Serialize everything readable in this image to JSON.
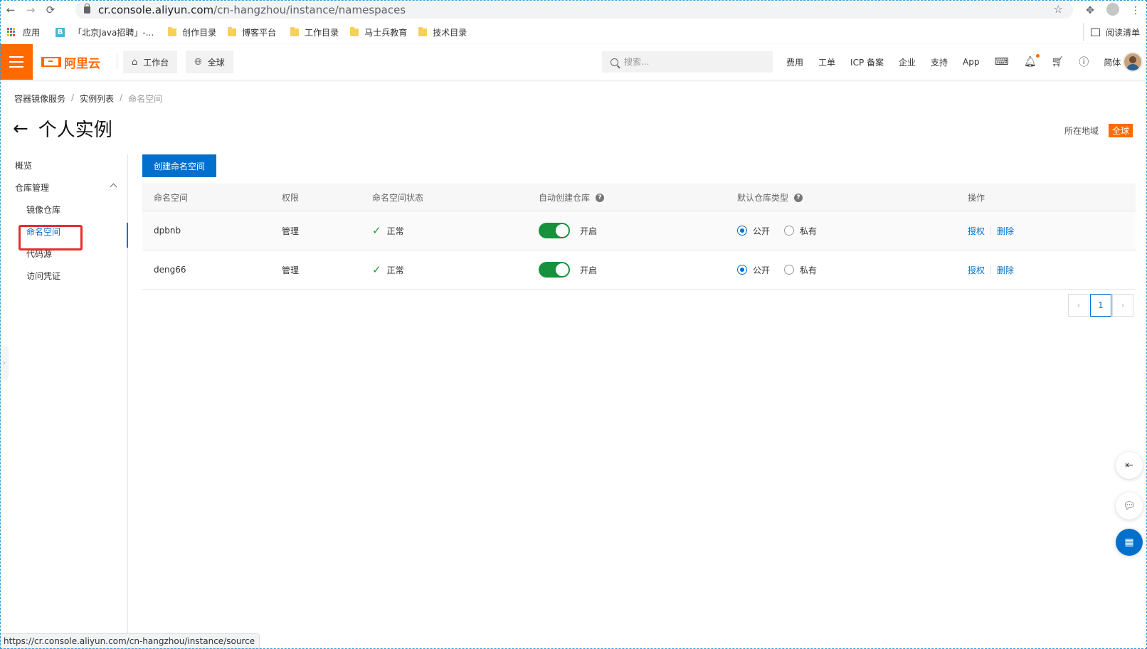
{
  "browser": {
    "url_host": "cr.console.aliyun.com",
    "url_path": "/cn-hangzhou/instance/namespaces",
    "bookmarks": [
      {
        "label": "应用",
        "type": "apps"
      },
      {
        "label": "「北京Java招聘」-...",
        "type": "b-icon"
      },
      {
        "label": "创作目录",
        "type": "folder"
      },
      {
        "label": "博客平台",
        "type": "folder"
      },
      {
        "label": "工作目录",
        "type": "folder"
      },
      {
        "label": "马士兵教育",
        "type": "folder"
      },
      {
        "label": "技术目录",
        "type": "folder"
      }
    ],
    "reading_list": "阅读清单",
    "status_url": "https://cr.console.aliyun.com/cn-hangzhou/instance/source"
  },
  "topbar": {
    "logo_text": "阿里云",
    "workbench": "工作台",
    "region_global": "全球",
    "search_placeholder": "搜索...",
    "links": [
      "费用",
      "工单",
      "ICP 备案",
      "企业",
      "支持",
      "App"
    ],
    "lang": "简体",
    "accent_color": "#ff6a00"
  },
  "breadcrumb": {
    "items": [
      "容器镜像服务",
      "实例列表"
    ],
    "current": "命名空间"
  },
  "page": {
    "title": "个人实例",
    "region_label": "所在地域",
    "region_value": "全球"
  },
  "sidebar": {
    "overview": "概览",
    "group": "仓库管理",
    "items": [
      "镜像仓库",
      "命名空间",
      "代码源",
      "访问凭证"
    ],
    "active_index": 1
  },
  "main": {
    "create_button": "创建命名空间",
    "columns": [
      "命名空间",
      "权限",
      "命名空间状态",
      "自动创建仓库",
      "默认仓库类型",
      "操作"
    ],
    "rows": [
      {
        "name": "dpbnb",
        "permission": "管理",
        "status": "正常",
        "auto_create": "开启",
        "auto_create_on": true,
        "type_public": "公开",
        "type_private": "私有",
        "selected": "公开",
        "action_auth": "授权",
        "action_delete": "删除"
      },
      {
        "name": "deng66",
        "permission": "管理",
        "status": "正常",
        "auto_create": "开启",
        "auto_create_on": true,
        "type_public": "公开",
        "type_private": "私有",
        "selected": "公开",
        "action_auth": "授权",
        "action_delete": "删除"
      }
    ],
    "pagination": {
      "current_page": "1"
    }
  },
  "colors": {
    "primary": "#0070cc",
    "toggle_on": "#18913c",
    "highlight": "#e62d2d"
  }
}
